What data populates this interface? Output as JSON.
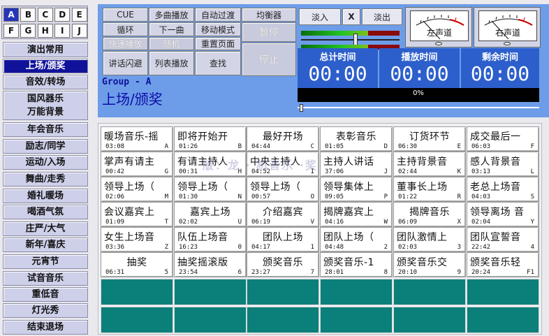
{
  "letters": [
    "A",
    "B",
    "C",
    "D",
    "E",
    "F",
    "G",
    "H",
    "I",
    "J"
  ],
  "active_letter": "A",
  "categories": [
    {
      "label": [
        "演出常用"
      ]
    },
    {
      "label": [
        "上场/颁奖"
      ],
      "active": true
    },
    {
      "label": [
        "音效/转场"
      ]
    },
    {
      "label": [
        "国风器乐",
        "万能背景"
      ]
    },
    {
      "label": [
        "年会音乐"
      ]
    },
    {
      "label": [
        "励志/同学"
      ]
    },
    {
      "label": [
        "运动/入场"
      ]
    },
    {
      "label": [
        "舞曲/走秀"
      ]
    },
    {
      "label": [
        "婚礼暖场"
      ]
    },
    {
      "label": [
        "喝酒气氛"
      ]
    },
    {
      "label": [
        "庄严/大气"
      ]
    },
    {
      "label": [
        "新年/喜庆"
      ]
    },
    {
      "label": [
        "元宵节"
      ]
    },
    {
      "label": [
        "试音音乐"
      ]
    },
    {
      "label": [
        "重低音"
      ]
    },
    {
      "label": [
        "灯光秀"
      ]
    },
    {
      "label": [
        "结束退场"
      ]
    }
  ],
  "controls": {
    "cue": "CUE",
    "multi_play": "多曲播放",
    "auto_fade": "自动过渡",
    "equalizer": "均衡器",
    "loop": "循环",
    "next": "下一曲",
    "move_mode": "移动模式",
    "pause": "暂停",
    "quick_play": "快速播放",
    "random": "随机",
    "reset_page": "重置页面",
    "stop": "停止",
    "speech_dodge": "讲话闪避",
    "list_play": "列表播放",
    "search": "查找"
  },
  "fade": {
    "fade_in": "淡入",
    "x": "X",
    "fade_out": "淡出"
  },
  "vu": {
    "left": "左声道",
    "right": "右声道"
  },
  "levels": {
    "meter1_fill": 0.68,
    "meter2_fill": 0.68,
    "slider_value": 0.55
  },
  "time": {
    "total_label": "总计时间",
    "total": "00:00",
    "played_label": "播放时间",
    "played": "00:00",
    "remaining_label": "剩余时间",
    "remaining": "00:00"
  },
  "progress": {
    "text": "0%",
    "value": 0
  },
  "group": {
    "label": "Group - A",
    "name": "上场/颁奖"
  },
  "watermark": "版：龙 · 机音乐 ·奖",
  "tracks": [
    {
      "title": "暖场音乐-摇",
      "dur": "03:08",
      "key": "A"
    },
    {
      "title": "即将开始开",
      "dur": "01:26",
      "key": "B"
    },
    {
      "title": "最好开场",
      "dur": "04:44",
      "key": "C"
    },
    {
      "title": "表彰音乐",
      "dur": "01:05",
      "key": "D"
    },
    {
      "title": "订货环节",
      "dur": "06:30",
      "key": "E"
    },
    {
      "title": "成交最后一",
      "dur": "06:03",
      "key": "F"
    },
    {
      "title": "掌声有请主",
      "dur": "00:42",
      "key": "G"
    },
    {
      "title": "有请主持人",
      "dur": "00:31",
      "key": "H"
    },
    {
      "title": "中央主持人",
      "dur": "04:52",
      "key": "I"
    },
    {
      "title": "主持人讲话",
      "dur": "37:06",
      "key": "J"
    },
    {
      "title": "主持背景音",
      "dur": "02:44",
      "key": "K"
    },
    {
      "title": "感人背景音",
      "dur": "03:13",
      "key": "L"
    },
    {
      "title": "领导上场（",
      "dur": "02:06",
      "key": "M"
    },
    {
      "title": "领导上场（",
      "dur": "01:30",
      "key": "N"
    },
    {
      "title": "领导上场（",
      "dur": "00:57",
      "key": "O"
    },
    {
      "title": "领导集体上",
      "dur": "09:05",
      "key": "P"
    },
    {
      "title": "董事长上场",
      "dur": "01:22",
      "key": "R"
    },
    {
      "title": "老总上场音",
      "dur": "04:03",
      "key": "S"
    },
    {
      "title": "会议嘉宾上",
      "dur": "01:09",
      "key": "T"
    },
    {
      "title": "嘉宾上场",
      "dur": "02:02",
      "key": "U"
    },
    {
      "title": "介绍嘉宾",
      "dur": "06:19",
      "key": "V"
    },
    {
      "title": "揭牌嘉宾上",
      "dur": "04:16",
      "key": "W"
    },
    {
      "title": "揭牌音乐",
      "dur": "06:09",
      "key": "X"
    },
    {
      "title": "领导离场 音",
      "dur": "02:04",
      "key": "Y"
    },
    {
      "title": "女生上场音",
      "dur": "03:36",
      "key": "Z"
    },
    {
      "title": "队伍上场音",
      "dur": "16:23",
      "key": "0"
    },
    {
      "title": "团队上场",
      "dur": "04:17",
      "key": "1"
    },
    {
      "title": "团队上场（",
      "dur": "04:48",
      "key": "2"
    },
    {
      "title": "团队激情上",
      "dur": "02:03",
      "key": "3"
    },
    {
      "title": "团队宣誓音",
      "dur": "22:42",
      "key": "4"
    },
    {
      "title": "抽奖",
      "dur": "06:31",
      "key": "5"
    },
    {
      "title": "抽奖摇滚版",
      "dur": "23:54",
      "key": "6"
    },
    {
      "title": "颁奖音乐",
      "dur": "23:27",
      "key": "7"
    },
    {
      "title": "颁奖音乐-1",
      "dur": "28:01",
      "key": "8"
    },
    {
      "title": "颁奖音乐交",
      "dur": "20:10",
      "key": "9"
    },
    {
      "title": "颁奖音乐轻",
      "dur": "20:24",
      "key": "F1"
    }
  ],
  "colors": {
    "panel": "#6d9de8",
    "active": "#11129a",
    "empty_cell": "#0b7f7a",
    "time_box": "#2d5fcc"
  }
}
